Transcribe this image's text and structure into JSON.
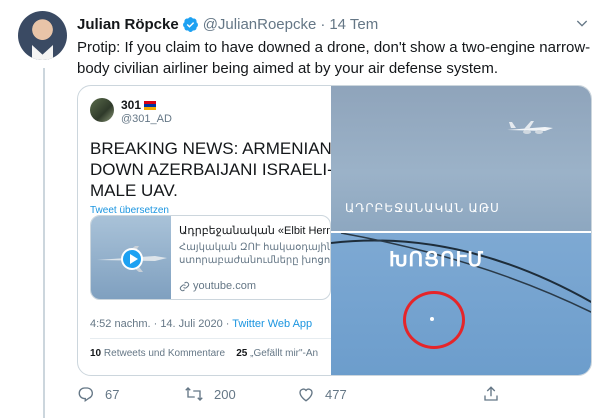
{
  "tweet": {
    "author_name": "Julian Röpcke",
    "handle": "@JulianRoepcke",
    "separator": "·",
    "date": "14 Tem",
    "text": "Protip: If you claim to have downed a drone, don't show a two-engine narrow-body civilian airliner being aimed at by your air defense system."
  },
  "quote": {
    "name": "301",
    "handle": "@301_AD",
    "text": "BREAKING NEWS: ARMENIAN AIR D\nDOWN AZERBAIJANI ISRAELI-MADI\nMALE UAV.",
    "translate": "Tweet übersetzen",
    "card": {
      "title": "Ադրբեջանական «Elbit Hermes",
      "description": "Հայկական ԶՈՒ հակաօդային ւ\nստորաբաժանումները խոցում",
      "link": "youtube.com"
    },
    "time": "4:52 nachm. · 14. Juli 2020 · ",
    "source": "Twitter Web App",
    "retweets_count": "10",
    "retweets_label": "Retweets und Kommentare",
    "likes_count": "25",
    "likes_label": "„Gefällt mir\"-An",
    "media_caption_1": "ԱԴՐԲԵՋԱՆԱԿԱՆ ԱԹՍ",
    "media_caption_2": "ԽՈՑՈՒՄ"
  },
  "actions": {
    "replies": "67",
    "retweets": "200",
    "likes": "477"
  },
  "colors": {
    "accent": "#1da1f2",
    "verified": "#1da1f2",
    "circle": "#e5252a"
  }
}
